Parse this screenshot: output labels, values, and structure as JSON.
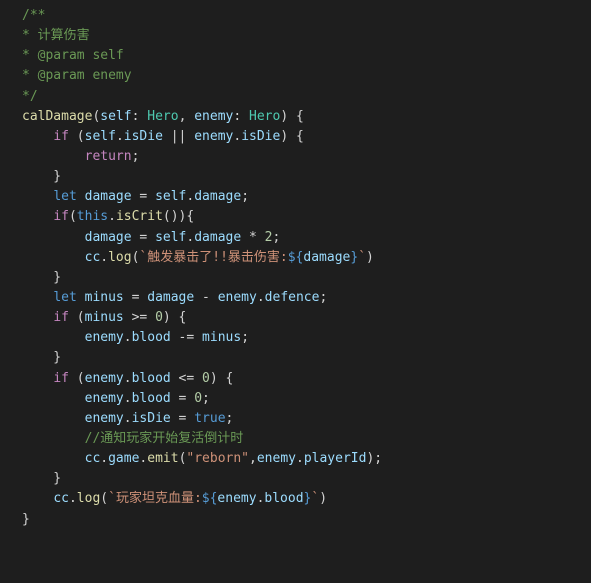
{
  "comment": {
    "open": "/**",
    "line1": "* 计算伤害",
    "line2": "* @param self",
    "line3": "* @param enemy",
    "close": "*/"
  },
  "kw": {
    "if": "if",
    "return": "return",
    "let": "let",
    "this": "this",
    "true": "true"
  },
  "fn": {
    "calDamage": "calDamage",
    "isCrit": "isCrit",
    "log": "log",
    "emit": "emit"
  },
  "ty": {
    "Hero": "Hero"
  },
  "id": {
    "self": "self",
    "enemy": "enemy",
    "isDie": "isDie",
    "damage": "damage",
    "cc": "cc",
    "minus": "minus",
    "defence": "defence",
    "blood": "blood",
    "game": "game",
    "playerId": "playerId"
  },
  "str": {
    "crit1": "触发暴击了!!暴击伤害:",
    "reborn": "\"reborn\"",
    "blood1": "玩家坦克血量:"
  },
  "num": {
    "two": "2",
    "zero": "0"
  },
  "comment2": "//通知玩家开始复活倒计时"
}
